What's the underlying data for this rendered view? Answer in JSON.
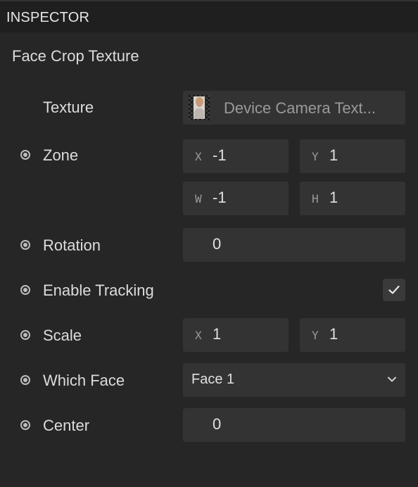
{
  "header": {
    "title": "INSPECTOR"
  },
  "section": {
    "title": "Face Crop Texture"
  },
  "texture": {
    "label": "Texture",
    "value": "Device Camera Text..."
  },
  "zone": {
    "label": "Zone",
    "x_axis": "X",
    "x": "-1",
    "y_axis": "Y",
    "y": "1",
    "w_axis": "W",
    "w": "-1",
    "h_axis": "H",
    "h": "1"
  },
  "rotation": {
    "label": "Rotation",
    "value": "0"
  },
  "enable_tracking": {
    "label": "Enable Tracking",
    "checked": true
  },
  "scale": {
    "label": "Scale",
    "x_axis": "X",
    "x": "1",
    "y_axis": "Y",
    "y": "1"
  },
  "which_face": {
    "label": "Which Face",
    "selected": "Face 1"
  },
  "center": {
    "label": "Center",
    "value": "0"
  },
  "icons": {
    "radio": "radio-dot-icon",
    "check": "check-icon",
    "chevron": "chevron-down-icon"
  },
  "colors": {
    "panel_bg": "#262626",
    "header_bg": "#1f1f1f",
    "field_bg": "#333333",
    "text": "#dcdcdc",
    "muted": "#9a9a9a"
  }
}
